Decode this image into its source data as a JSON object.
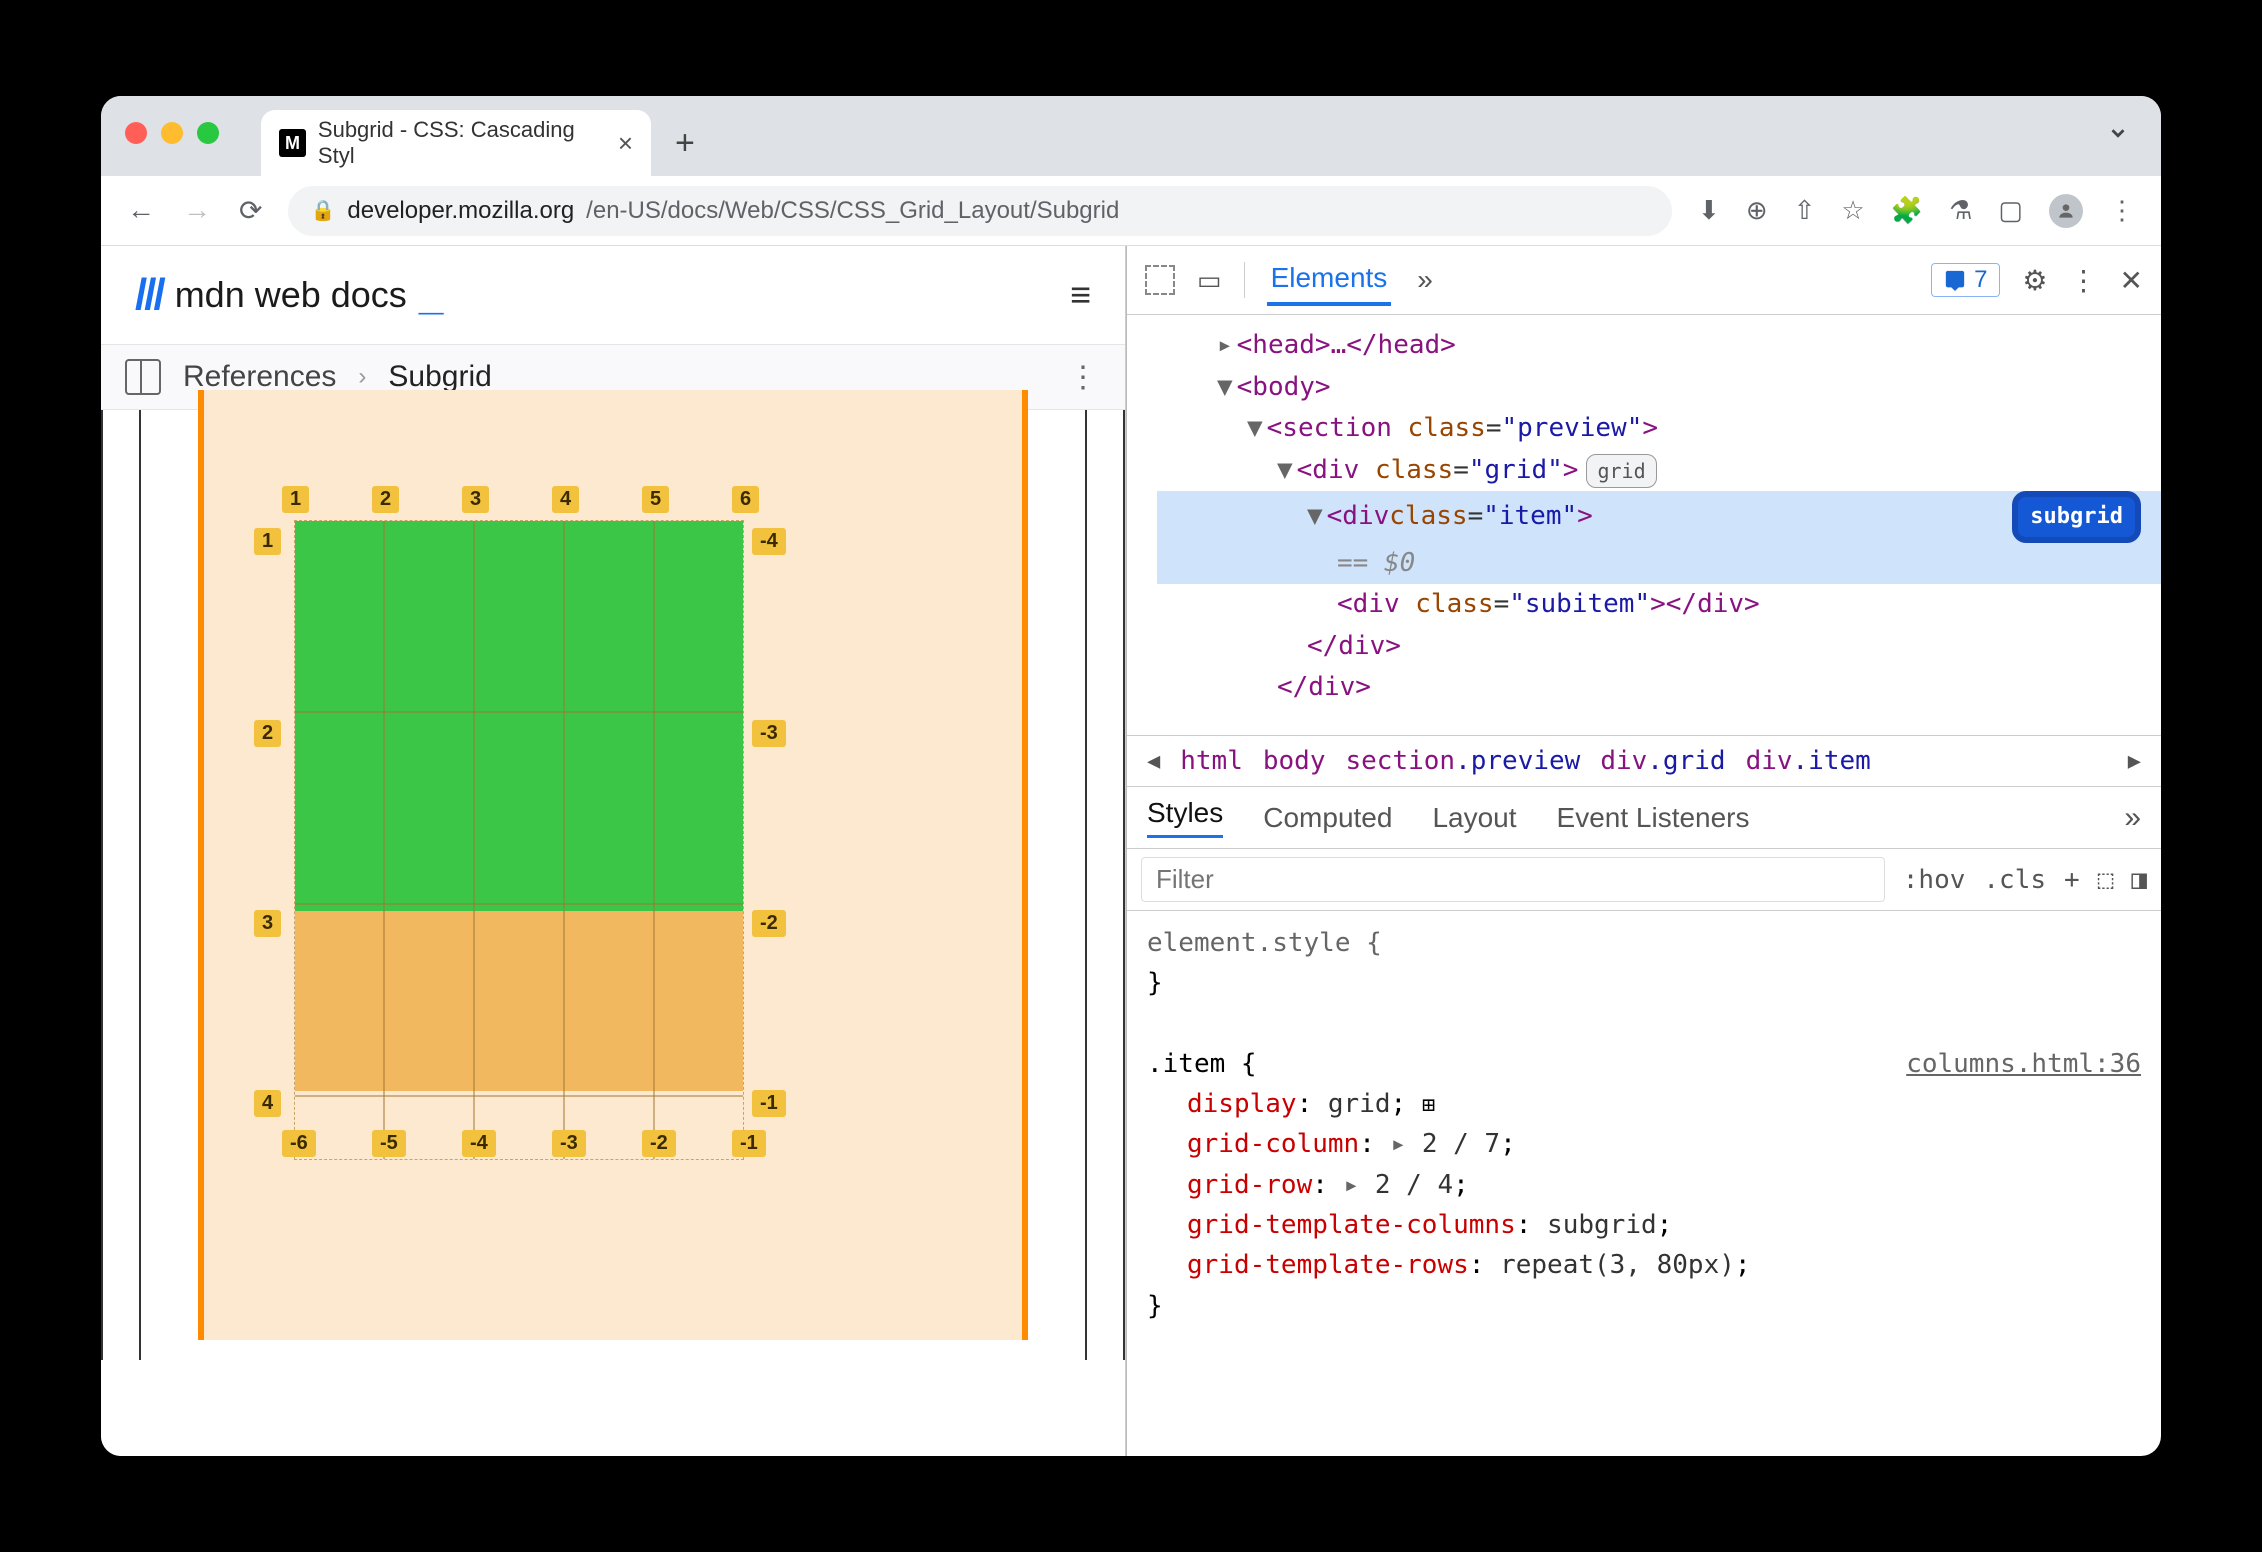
{
  "browser": {
    "tab_title": "Subgrid - CSS: Cascading Styl",
    "favicon_letter": "M",
    "url_domain": "developer.mozilla.org",
    "url_path": "/en-US/docs/Web/CSS/CSS_Grid_Layout/Subgrid"
  },
  "mdn": {
    "logo_text": "mdn web docs",
    "breadcrumb_1": "References",
    "breadcrumb_2": "Subgrid"
  },
  "grid_labels": {
    "top": [
      "1",
      "2",
      "3",
      "4",
      "5",
      "6"
    ],
    "left": [
      "1",
      "2",
      "3",
      "4"
    ],
    "right": [
      "-4",
      "-3",
      "-2",
      "-1"
    ],
    "bottom": [
      "-6",
      "-5",
      "-4",
      "-3",
      "-2",
      "-1"
    ]
  },
  "devtools": {
    "panel": "Elements",
    "issues_count": "7",
    "dom": {
      "head": "<head>…</head>",
      "body_open": "<body>",
      "section": "<section class=\"preview\">",
      "grid": "<div class=\"grid\">",
      "grid_badge": "grid",
      "item": "<div class=\"item\">",
      "item_badge": "subgrid",
      "eq": "== $0",
      "subitem": "<div class=\"subitem\"></div>",
      "item_close": "</div>",
      "grid_close": "</div>"
    },
    "path": [
      "html",
      "body",
      "section",
      ".preview",
      "div",
      ".grid",
      "div",
      ".item"
    ],
    "subtabs": [
      "Styles",
      "Computed",
      "Layout",
      "Event Listeners"
    ],
    "filter_placeholder": "Filter",
    "hov": ":hov",
    "cls": ".cls",
    "styles": {
      "element_style": "element.style {",
      "close": "}",
      "item_selector": ".item {",
      "source": "columns.html:36",
      "display": "display: grid;",
      "grid_column": "grid-column: ▸ 2 / 7;",
      "grid_row": "grid-row: ▸ 2 / 4;",
      "gtc": "grid-template-columns: subgrid;",
      "gtr": "grid-template-rows: repeat(3, 80px);"
    }
  }
}
